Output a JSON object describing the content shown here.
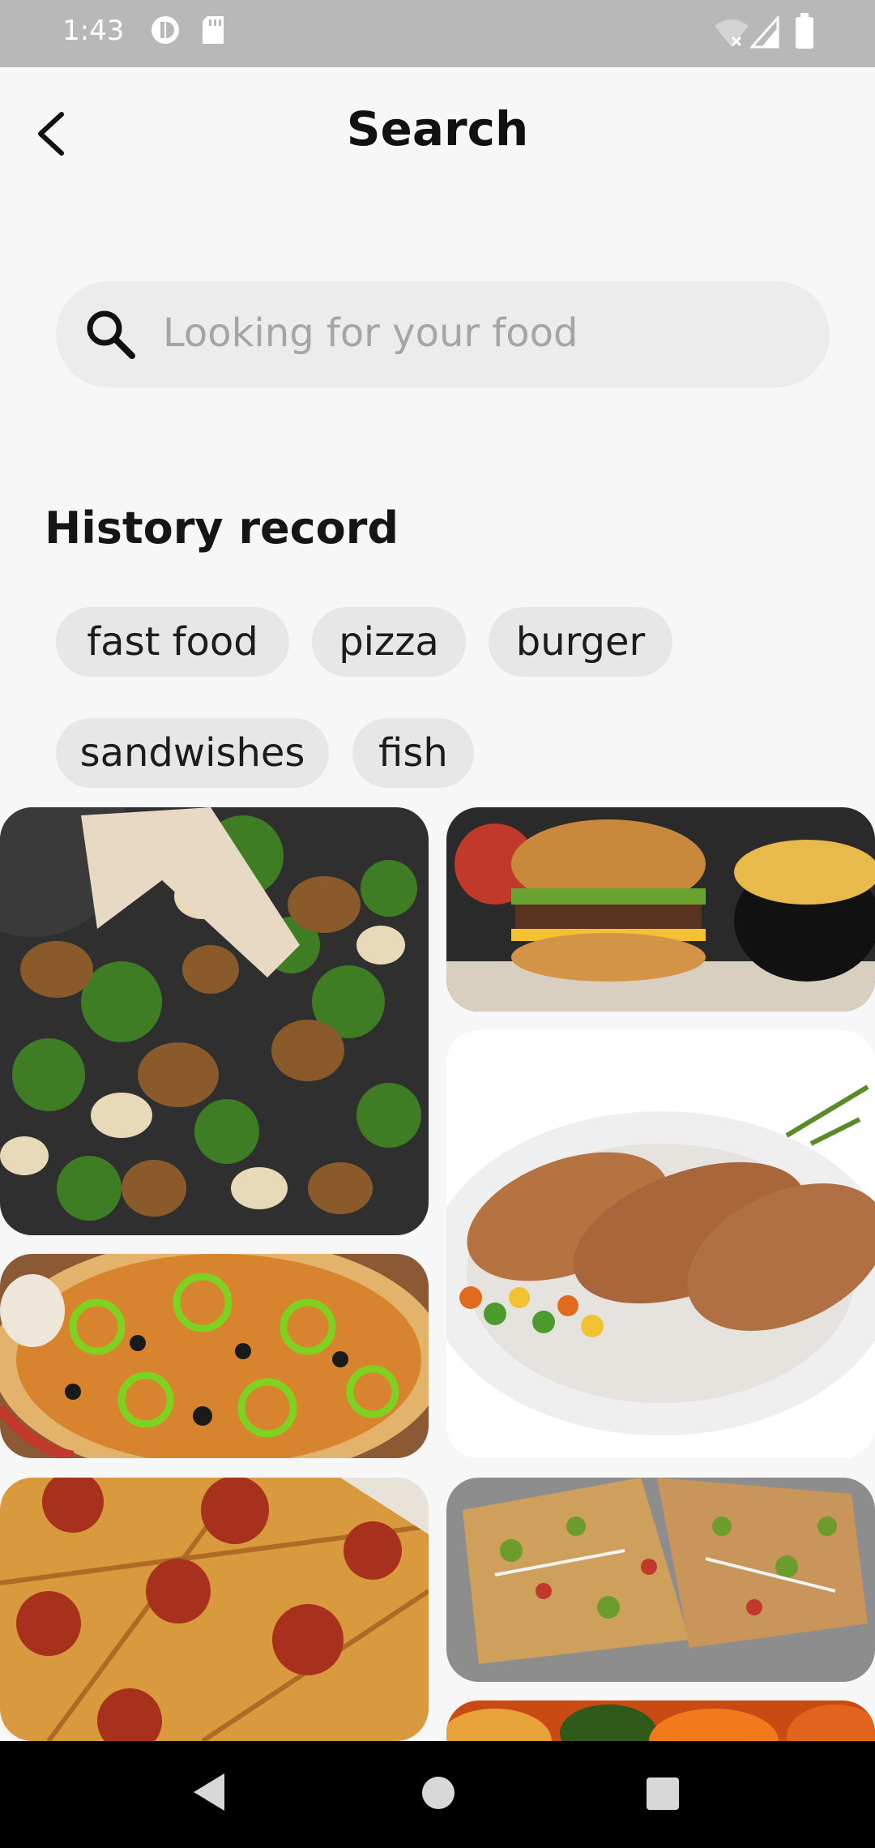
{
  "status_bar": {
    "time": "1:43"
  },
  "app_bar": {
    "title": "Search"
  },
  "search": {
    "placeholder": "Looking for your food"
  },
  "history": {
    "title": "History record",
    "chips": [
      "fast food",
      "pizza",
      "burger",
      "sandwishes",
      "fish"
    ]
  },
  "gallery": {
    "tiles": [
      {
        "name": "chicken-broccoli-mushroom-image"
      },
      {
        "name": "burger-fries-image"
      },
      {
        "name": "grilled-chicken-image"
      },
      {
        "name": "veggie-pizza-image"
      },
      {
        "name": "pepperoni-pizza-image"
      },
      {
        "name": "loaded-flatbread-pizza-image"
      },
      {
        "name": "peppers-image"
      }
    ]
  },
  "colors": {
    "status_bar": "#b8b8b8",
    "background": "#f7f7f7",
    "chip": "#e7e7e7",
    "search": "#ececec"
  }
}
